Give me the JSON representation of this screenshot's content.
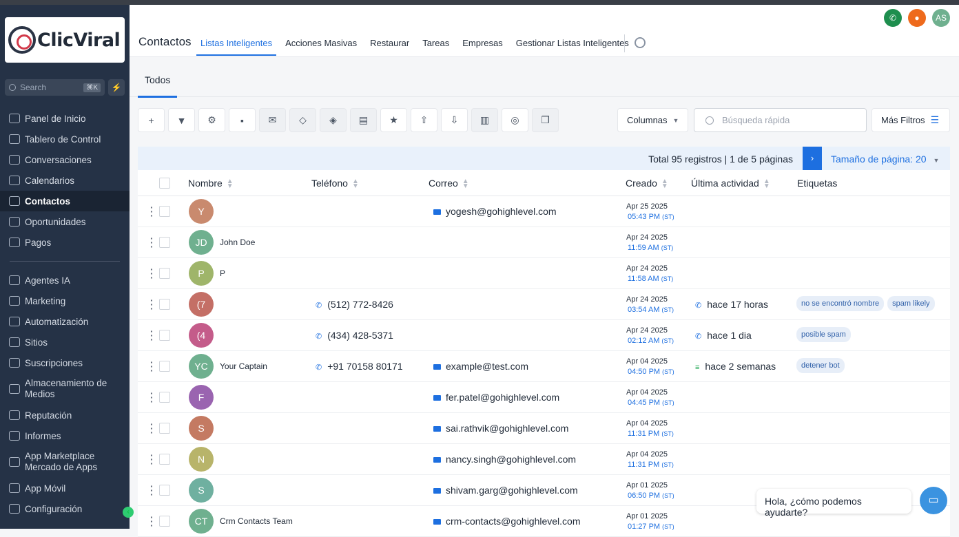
{
  "brand": {
    "name": "ClicViral"
  },
  "sidebar": {
    "search_placeholder": "Search",
    "search_shortcut": "⌘K",
    "items_top": [
      {
        "label": "Panel de Inicio",
        "icon": "home-icon"
      },
      {
        "label": "Tablero de Control",
        "icon": "dashboard-icon"
      },
      {
        "label": "Conversaciones",
        "icon": "chat-icon"
      },
      {
        "label": "Calendarios",
        "icon": "calendar-icon"
      },
      {
        "label": "Contactos",
        "icon": "contacts-icon",
        "active": true
      },
      {
        "label": "Oportunidades",
        "icon": "opportunities-icon"
      },
      {
        "label": "Pagos",
        "icon": "payments-icon"
      }
    ],
    "items_bottom": [
      {
        "label": "Agentes IA",
        "icon": "sparkle-icon"
      },
      {
        "label": "Marketing",
        "icon": "send-icon"
      },
      {
        "label": "Automatización",
        "icon": "automation-icon"
      },
      {
        "label": "Sitios",
        "icon": "sites-icon"
      },
      {
        "label": "Suscripciones",
        "icon": "subscriptions-icon"
      },
      {
        "label": "Almacenamiento de Medios",
        "icon": "media-icon"
      },
      {
        "label": "Reputación",
        "icon": "star-icon"
      },
      {
        "label": "Informes",
        "icon": "chart-icon"
      },
      {
        "label": "App Marketplace Mercado de Apps",
        "icon": "grid-icon"
      },
      {
        "label": "App Móvil",
        "icon": "mobile-icon"
      },
      {
        "label": "Configuración",
        "icon": "gear-icon"
      }
    ]
  },
  "topbar": {
    "title": "Contactos",
    "tabs": [
      "Listas Inteligentes",
      "Acciones Masivas",
      "Restaurar",
      "Tareas",
      "Empresas",
      "Gestionar Listas Inteligentes"
    ],
    "user_initials": "AS"
  },
  "subtab": "Todos",
  "toolbar": {
    "columns_label": "Columnas",
    "search_placeholder": "Búsqueda rápida",
    "more_filters_label": "Más Filtros"
  },
  "pager": {
    "total_text": "Total 95 registros | 1 de 5 páginas",
    "page_size_text": "Tamaño de página: 20"
  },
  "table": {
    "headers": [
      "Nombre",
      "Teléfono",
      "Correo",
      "Creado",
      "Última actividad",
      "Etiquetas"
    ],
    "rows": [
      {
        "initials": "Y",
        "color": "#c98a6e",
        "name": "",
        "phone": "",
        "email": "yogesh@gohighlevel.com",
        "date": "Apr 25 2025",
        "time": "05:43 PM",
        "tz": "(ST)",
        "activity": "",
        "activity_icon": "",
        "tags": []
      },
      {
        "initials": "JD",
        "color": "#6fb08f",
        "name": "John Doe",
        "phone": "",
        "email": "",
        "date": "Apr 24 2025",
        "time": "11:59 AM",
        "tz": "(ST)",
        "activity": "",
        "activity_icon": "",
        "tags": []
      },
      {
        "initials": "P",
        "color": "#9fb56a",
        "name": "P",
        "phone": "",
        "email": "",
        "date": "Apr 24 2025",
        "time": "11:58 AM",
        "tz": "(ST)",
        "activity": "",
        "activity_icon": "",
        "tags": []
      },
      {
        "initials": "(7",
        "color": "#c46f66",
        "name": "",
        "phone": "(512) 772-8426",
        "email": "",
        "date": "Apr 24 2025",
        "time": "03:54 AM",
        "tz": "(ST)",
        "activity": "hace 17 horas",
        "activity_icon": "phone",
        "tags": [
          "no se encontró nombre",
          "spam likely"
        ]
      },
      {
        "initials": "(4",
        "color": "#c45c8a",
        "name": "",
        "phone": "(434) 428-5371",
        "email": "",
        "date": "Apr 24 2025",
        "time": "02:12 AM",
        "tz": "(ST)",
        "activity": "hace 1 dia",
        "activity_icon": "phone",
        "tags": [
          "posible spam"
        ]
      },
      {
        "initials": "YC",
        "color": "#6fb08f",
        "name": "Your Captain",
        "phone": "+91 70158 80171",
        "email": "example@test.com",
        "date": "Apr 04 2025",
        "time": "04:50 PM",
        "tz": "(ST)",
        "activity": "hace 2 semanas",
        "activity_icon": "list",
        "tags": [
          "detener bot"
        ]
      },
      {
        "initials": "F",
        "color": "#9a64b0",
        "name": "",
        "phone": "",
        "email": "fer.patel@gohighlevel.com",
        "date": "Apr 04 2025",
        "time": "04:45 PM",
        "tz": "(ST)",
        "activity": "",
        "activity_icon": "",
        "tags": []
      },
      {
        "initials": "S",
        "color": "#c47a62",
        "name": "",
        "phone": "",
        "email": "sai.rathvik@gohighlevel.com",
        "date": "Apr 04 2025",
        "time": "11:31 PM",
        "tz": "(ST)",
        "activity": "",
        "activity_icon": "",
        "tags": []
      },
      {
        "initials": "N",
        "color": "#b8b46a",
        "name": "",
        "phone": "",
        "email": "nancy.singh@gohighlevel.com",
        "date": "Apr 04 2025",
        "time": "11:31 PM",
        "tz": "(ST)",
        "activity": "",
        "activity_icon": "",
        "tags": []
      },
      {
        "initials": "S",
        "color": "#6fb0a0",
        "name": "",
        "phone": "",
        "email": "shivam.garg@gohighlevel.com",
        "date": "Apr 01 2025",
        "time": "06:50 PM",
        "tz": "(ST)",
        "activity": "",
        "activity_icon": "",
        "tags": []
      },
      {
        "initials": "CT",
        "color": "#6fb08f",
        "name": "Crm Contacts Team",
        "phone": "",
        "email": "crm-contacts@gohighlevel.com",
        "date": "Apr 01 2025",
        "time": "01:27 PM",
        "tz": "(ST)",
        "activity": "",
        "activity_icon": "",
        "tags": []
      }
    ]
  },
  "chat": {
    "bubble_text": "Hola, ¿cómo podemos ayudarte?"
  },
  "colors": {
    "sidebar_bg": "#253246",
    "accent": "#1d6fe0",
    "phone_btn": "#1e8e4e",
    "notif_btn": "#ee6a1c",
    "avatar_user": "#6fb08f"
  }
}
